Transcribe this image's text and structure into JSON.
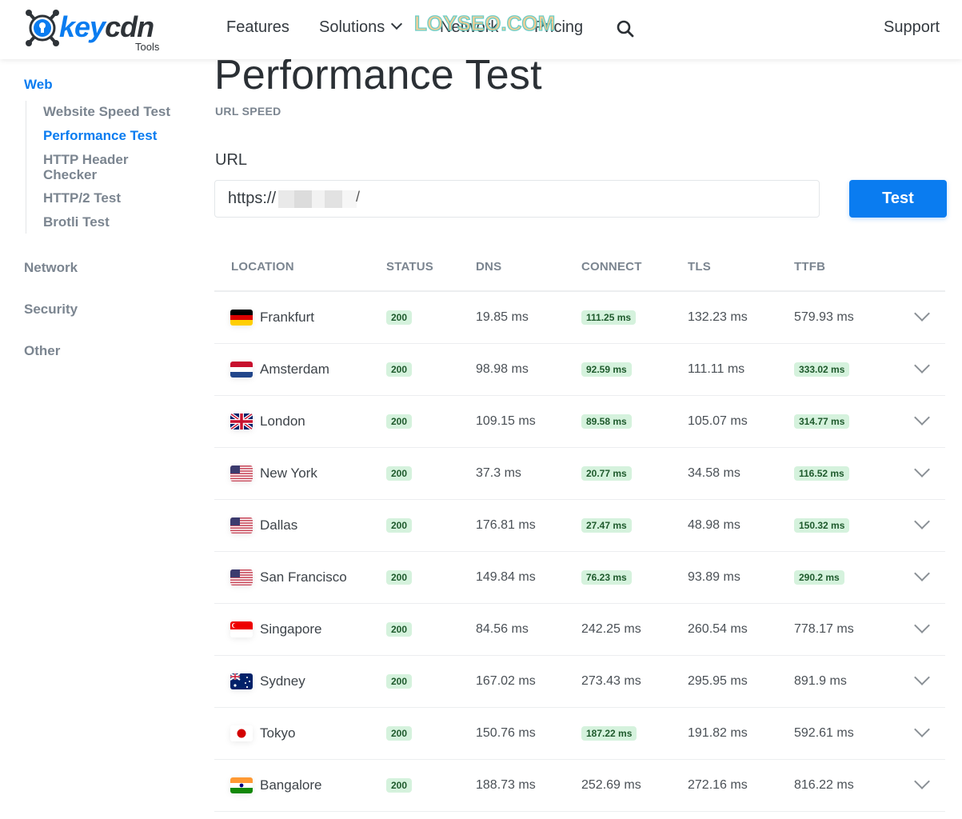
{
  "brand": {
    "name_key": "key",
    "name_cdn": "cdn",
    "sub": "Tools",
    "accent": "#0a7cf0"
  },
  "nav": {
    "features": "Features",
    "solutions": "Solutions",
    "network": "Network",
    "pricing": "Pricing",
    "support": "Support",
    "search_icon": "search-icon"
  },
  "watermark": "LOYSEO.COM",
  "sidebar": {
    "groups": [
      {
        "label": "Web",
        "active": true
      },
      {
        "label": "Network"
      },
      {
        "label": "Security"
      },
      {
        "label": "Other"
      }
    ],
    "web_links": [
      {
        "label": "Website Speed Test"
      },
      {
        "label": "Performance Test",
        "active": true
      },
      {
        "label": "HTTP Header Checker"
      },
      {
        "label": "HTTP/2 Test"
      },
      {
        "label": "Brotli Test"
      }
    ]
  },
  "main": {
    "title": "Performance Test",
    "subtitle": "URL SPEED",
    "url_label": "URL",
    "url_value": "https://",
    "url_suffix": "/",
    "test_button": "Test"
  },
  "table": {
    "headers": [
      "LOCATION",
      "STATUS",
      "DNS",
      "CONNECT",
      "TLS",
      "TTFB"
    ],
    "rows": [
      {
        "location": "Frankfurt",
        "flag": "de",
        "status": "200",
        "dns": "19.85 ms",
        "connect": "111.25 ms",
        "connect_good": true,
        "tls": "132.23 ms",
        "ttfb": "579.93 ms",
        "ttfb_good": false
      },
      {
        "location": "Amsterdam",
        "flag": "nl",
        "status": "200",
        "dns": "98.98 ms",
        "connect": "92.59 ms",
        "connect_good": true,
        "tls": "111.11 ms",
        "ttfb": "333.02 ms",
        "ttfb_good": true
      },
      {
        "location": "London",
        "flag": "gb",
        "status": "200",
        "dns": "109.15 ms",
        "connect": "89.58 ms",
        "connect_good": true,
        "tls": "105.07 ms",
        "ttfb": "314.77 ms",
        "ttfb_good": true
      },
      {
        "location": "New York",
        "flag": "us",
        "status": "200",
        "dns": "37.3 ms",
        "connect": "20.77 ms",
        "connect_good": true,
        "tls": "34.58 ms",
        "ttfb": "116.52 ms",
        "ttfb_good": true
      },
      {
        "location": "Dallas",
        "flag": "us",
        "status": "200",
        "dns": "176.81 ms",
        "connect": "27.47 ms",
        "connect_good": true,
        "tls": "48.98 ms",
        "ttfb": "150.32 ms",
        "ttfb_good": true
      },
      {
        "location": "San Francisco",
        "flag": "us",
        "status": "200",
        "dns": "149.84 ms",
        "connect": "76.23 ms",
        "connect_good": true,
        "tls": "93.89 ms",
        "ttfb": "290.2 ms",
        "ttfb_good": true
      },
      {
        "location": "Singapore",
        "flag": "sg",
        "status": "200",
        "dns": "84.56 ms",
        "connect": "242.25 ms",
        "connect_good": false,
        "tls": "260.54 ms",
        "ttfb": "778.17 ms",
        "ttfb_good": false
      },
      {
        "location": "Sydney",
        "flag": "au",
        "status": "200",
        "dns": "167.02 ms",
        "connect": "273.43 ms",
        "connect_good": false,
        "tls": "295.95 ms",
        "ttfb": "891.9 ms",
        "ttfb_good": false
      },
      {
        "location": "Tokyo",
        "flag": "jp",
        "status": "200",
        "dns": "150.76 ms",
        "connect": "187.22 ms",
        "connect_good": true,
        "tls": "191.82 ms",
        "ttfb": "592.61 ms",
        "ttfb_good": false
      },
      {
        "location": "Bangalore",
        "flag": "in",
        "status": "200",
        "dns": "188.73 ms",
        "connect": "252.69 ms",
        "connect_good": false,
        "tls": "272.16 ms",
        "ttfb": "816.22 ms",
        "ttfb_good": false
      }
    ]
  }
}
